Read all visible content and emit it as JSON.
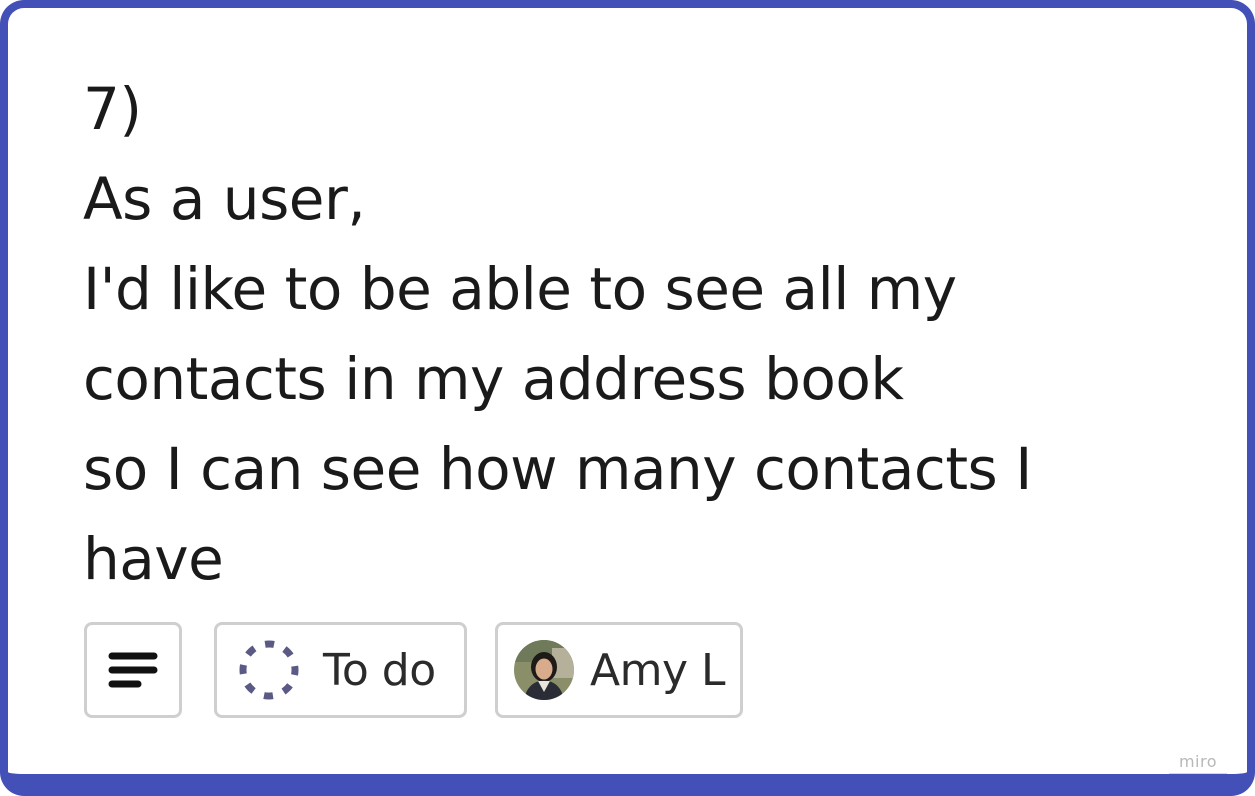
{
  "card": {
    "lines": [
      "7)",
      "As a user,",
      "I'd like to be able to see all my",
      "contacts in my address book",
      "so I can see how many contacts I",
      "have"
    ],
    "border_color": "#4350b8"
  },
  "chips": {
    "description_icon": "lines-icon",
    "status": {
      "label": "To do",
      "icon": "dashed-circle-icon",
      "icon_color": "#5b5a85"
    },
    "assignee": {
      "name": "Amy L",
      "avatar_icon": "avatar"
    }
  },
  "watermark": {
    "label": "miro"
  }
}
